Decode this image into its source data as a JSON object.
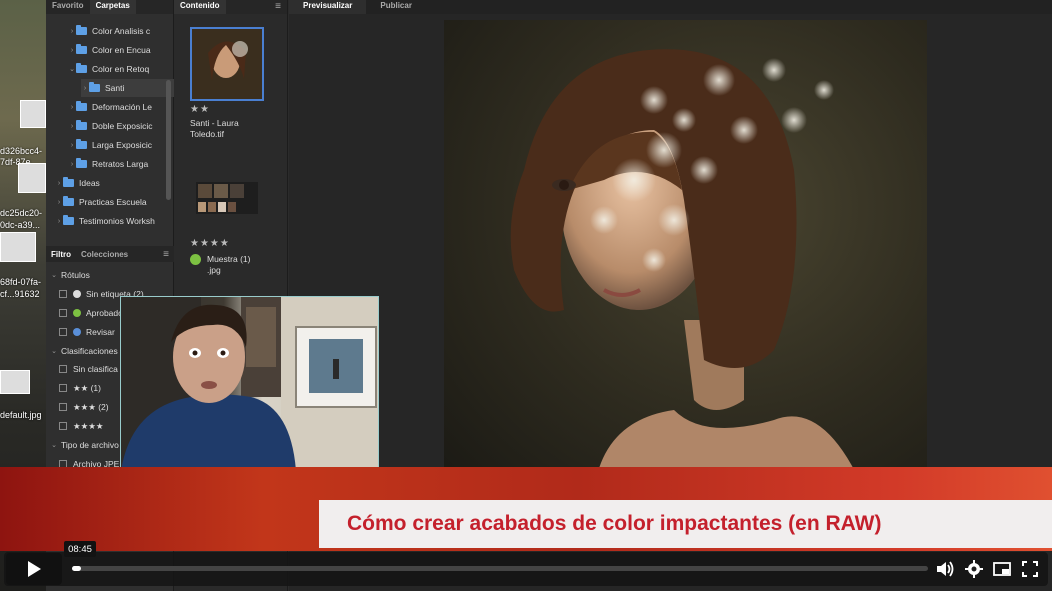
{
  "desktop": {
    "labels": [
      "d326bcc4-",
      "7df-87e",
      "dc25dc20-",
      "0dc-a39...",
      "68fd-07fa-",
      "cf...91632",
      "default.jpg"
    ]
  },
  "left_panel": {
    "tabs": [
      "Favorito",
      "Carpetas"
    ],
    "active_tab": "Carpetas",
    "folders": [
      {
        "label": "Color Analisis c",
        "indent": 2,
        "expanded": false
      },
      {
        "label": "Color en Encua",
        "indent": 2,
        "expanded": false
      },
      {
        "label": "Color en Retoq",
        "indent": 2,
        "expanded": true
      },
      {
        "label": "Santi",
        "indent": 3,
        "expanded": false,
        "selected": true
      },
      {
        "label": "Deformación Le",
        "indent": 2,
        "expanded": false
      },
      {
        "label": "Doble Exposicic",
        "indent": 2,
        "expanded": false
      },
      {
        "label": "Larga Exposicic",
        "indent": 2,
        "expanded": false
      },
      {
        "label": "Retratos Larga",
        "indent": 2,
        "expanded": false
      },
      {
        "label": "Ideas",
        "indent": 1,
        "expanded": false
      },
      {
        "label": "Practicas Escuela",
        "indent": 1,
        "expanded": false
      },
      {
        "label": "Testimonios Worksh",
        "indent": 1,
        "expanded": false
      }
    ],
    "filter_tabs": [
      "Filtro",
      "Colecciones"
    ],
    "filter_sections": {
      "rotulos": "Rótulos",
      "clasificaciones": "Clasificaciones",
      "tipo_archivo": "Tipo de archivo"
    },
    "rotulos_items": [
      {
        "label": "Sin etiqueta (2)",
        "color": "#dddddd"
      },
      {
        "label": "Aprobado",
        "color": "#7dc142"
      },
      {
        "label": "Revisar",
        "color": "#5a8fd8"
      }
    ],
    "clasificaciones_items": [
      {
        "label": "Sin clasifica"
      },
      {
        "label": "★★ (1)"
      },
      {
        "label": "★★★ (2)"
      },
      {
        "label": "★★★★"
      }
    ],
    "tipo_items": [
      {
        "label": "Archivo JPE"
      }
    ]
  },
  "content_panel": {
    "title": "Contenido",
    "items": [
      {
        "stars": "★★",
        "title": "Santi - Laura Toledo.tif"
      },
      {
        "stars": "★★★★",
        "title": "Muestra (1) .jpg",
        "label_color": "#7dc142"
      }
    ]
  },
  "preview": {
    "tabs": [
      "Previsualizar",
      "Publicar"
    ],
    "active_tab": "Previsualizar"
  },
  "banner": {
    "title": "Cómo crear acabados de color impactantes (en RAW)"
  },
  "player": {
    "current_time": "08:45",
    "progress": 0.01,
    "icons": [
      "play-icon",
      "volume-icon",
      "settings-icon",
      "pip-icon",
      "fullscreen-icon"
    ]
  },
  "colors": {
    "folder_blue": "#5ea0e6",
    "selection_blue": "#4a7fd1",
    "banner_red": "#c4202c"
  }
}
